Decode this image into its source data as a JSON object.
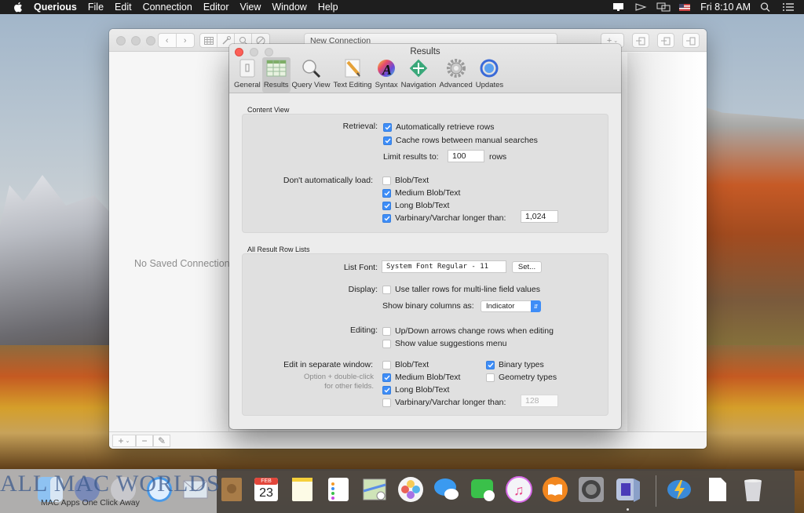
{
  "menubar": {
    "app_name": "Querious",
    "items": [
      "File",
      "Edit",
      "Connection",
      "Editor",
      "View",
      "Window",
      "Help"
    ],
    "clock": "Fri 8:10 AM",
    "status_icons": [
      "display-icon",
      "location-icon",
      "airplay-icon",
      "flag-us-icon",
      "search-icon",
      "list-icon"
    ]
  },
  "main_window": {
    "address_text": "New Connection",
    "no_saved_text": "No Saved Connections",
    "toolbar_left_icons": [
      "back-icon",
      "forward-icon",
      "table-icon",
      "wrench-icon",
      "search-icon",
      "compass-icon"
    ],
    "toolbar_right_icons": [
      "add-icon",
      "import-icon",
      "export-icon",
      "disconnect-icon"
    ],
    "bottom_buttons": [
      "+",
      "−",
      "✎"
    ]
  },
  "prefs": {
    "title": "Results",
    "tabs": [
      {
        "label": "General",
        "icon": "switch-icon",
        "selected": false
      },
      {
        "label": "Results",
        "icon": "table-grid-icon",
        "selected": true
      },
      {
        "label": "Query View",
        "icon": "magnifier-icon",
        "selected": false
      },
      {
        "label": "Text Editing",
        "icon": "pencil-icon",
        "selected": false
      },
      {
        "label": "Syntax",
        "icon": "color-wheel-icon",
        "selected": false
      },
      {
        "label": "Navigation",
        "icon": "arrows-icon",
        "selected": false
      },
      {
        "label": "Advanced",
        "icon": "gear-icon",
        "selected": false
      },
      {
        "label": "Updates",
        "icon": "updates-icon",
        "selected": false
      }
    ],
    "content_view": {
      "section_label": "Content View",
      "retrieval_label": "Retrieval:",
      "auto_retrieve": {
        "label": "Automatically retrieve rows",
        "checked": true
      },
      "cache_rows": {
        "label": "Cache rows between manual searches",
        "checked": true
      },
      "limit_label": "Limit results to:",
      "limit_value": "100",
      "limit_unit": "rows",
      "dont_load_label": "Don't automatically load:",
      "dont_load": [
        {
          "label": "Blob/Text",
          "checked": false
        },
        {
          "label": "Medium Blob/Text",
          "checked": true
        },
        {
          "label": "Long Blob/Text",
          "checked": true
        },
        {
          "label": "Varbinary/Varchar longer than:",
          "checked": true
        }
      ],
      "varchar_limit": "1,024"
    },
    "row_lists": {
      "section_label": "All Result Row Lists",
      "list_font_label": "List Font:",
      "list_font_value": "System Font Regular - 11",
      "set_button": "Set...",
      "display_label": "Display:",
      "taller_rows": {
        "label": "Use taller rows for multi-line field values",
        "checked": false
      },
      "binary_label": "Show binary columns as:",
      "binary_value": "Indicator",
      "editing_label": "Editing:",
      "updown": {
        "label": "Up/Down arrows change rows when editing",
        "checked": false
      },
      "suggestions": {
        "label": "Show value suggestions menu",
        "checked": false
      },
      "separate_label": "Edit in separate window:",
      "separate_hint_1": "Option + double-click",
      "separate_hint_2": "for other fields.",
      "separate_left": [
        {
          "label": "Blob/Text",
          "checked": false
        },
        {
          "label": "Medium Blob/Text",
          "checked": true
        },
        {
          "label": "Long Blob/Text",
          "checked": true
        },
        {
          "label": "Varbinary/Varchar longer than:",
          "checked": false
        }
      ],
      "separate_right": [
        {
          "label": "Binary types",
          "checked": true
        },
        {
          "label": "Geometry types",
          "checked": false
        }
      ],
      "separate_varchar_value": "128"
    }
  },
  "dock": {
    "watermark": "ALL MAC WORLDS",
    "watermark_sub": "MAC Apps One Click Away",
    "items": [
      "Finder",
      "Siri",
      "Launchpad",
      "Safari",
      "Mail",
      "Contacts",
      "Calendar",
      "Notes",
      "Reminders",
      "Maps",
      "Photos",
      "Messages",
      "FaceTime",
      "iTunes",
      "iBooks",
      "System Preferences",
      "Querious",
      "Downloads",
      "Document",
      "Trash"
    ],
    "calendar_month": "FEB",
    "calendar_day": "23"
  }
}
